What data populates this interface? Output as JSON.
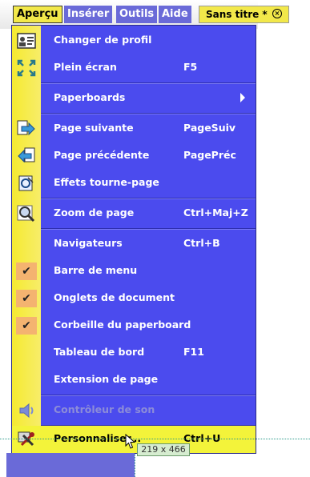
{
  "menubar": {
    "items": [
      {
        "label": "Aperçu",
        "active": true
      },
      {
        "label": "Insérer",
        "active": false
      },
      {
        "label": "Outils",
        "active": false
      },
      {
        "label": "Aide",
        "active": false
      }
    ],
    "document_tab": {
      "title": "Sans titre *",
      "close_icon": "close-circle-icon"
    }
  },
  "menu": {
    "items": [
      {
        "label": "Changer de profil",
        "shortcut": "",
        "icon": "profile-card-icon"
      },
      {
        "label": "Plein écran",
        "shortcut": "F5",
        "icon": "fullscreen-icon"
      },
      {
        "label": "Paperboards",
        "shortcut": "",
        "submenu": true
      },
      {
        "label": "Page suivante",
        "shortcut": "PageSuiv",
        "icon": "next-page-icon"
      },
      {
        "label": "Page précédente",
        "shortcut": "PagePréc",
        "icon": "previous-page-icon"
      },
      {
        "label": "Effets tourne-page",
        "shortcut": "",
        "icon": "page-turn-icon"
      },
      {
        "label": "Zoom de page",
        "shortcut": "Ctrl+Maj+Z",
        "icon": "magnifier-icon"
      },
      {
        "label": "Navigateurs",
        "shortcut": "Ctrl+B"
      },
      {
        "label": "Barre de menu",
        "shortcut": "",
        "checked": true
      },
      {
        "label": "Onglets de document",
        "shortcut": "",
        "checked": true
      },
      {
        "label": "Corbeille du paperboard",
        "shortcut": "",
        "checked": true
      },
      {
        "label": "Tableau de bord",
        "shortcut": "F11"
      },
      {
        "label": "Extension de page",
        "shortcut": ""
      },
      {
        "label": "Contrôleur de son",
        "shortcut": "",
        "icon": "speaker-icon",
        "disabled": true
      },
      {
        "label": "Personnaliser...",
        "shortcut": "Ctrl+U",
        "icon": "customize-tools-icon",
        "highlighted": true
      }
    ]
  },
  "size_tooltip": "219 x 466",
  "colors": {
    "menu_bg": "#4b4bee",
    "gutter": "#f5ea30",
    "highlight": "#f3f33a",
    "check_bg": "#f4b370"
  }
}
